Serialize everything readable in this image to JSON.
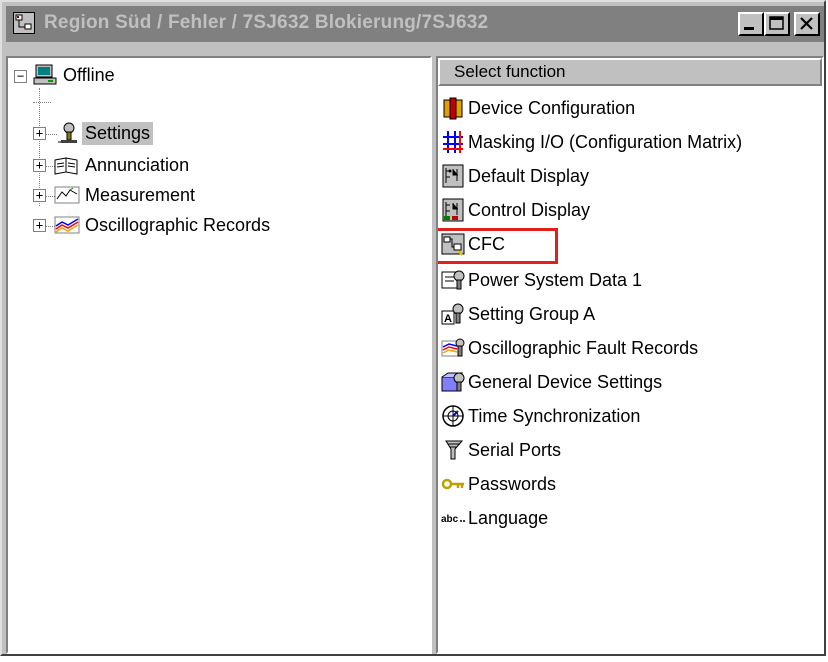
{
  "window": {
    "title": "Region Süd / Fehler / 7SJ632 Blokierung/7SJ632",
    "buttons": [
      "minimize",
      "maximize",
      "close"
    ]
  },
  "tree": {
    "root": {
      "label": "Offline",
      "icon": "computer-icon"
    },
    "items": [
      {
        "label": "Settings",
        "icon": "settings-icon",
        "selected": true
      },
      {
        "label": "Annunciation",
        "icon": "book-icon",
        "selected": false
      },
      {
        "label": "Measurement",
        "icon": "measurement-icon",
        "selected": false
      },
      {
        "label": "Oscillographic Records",
        "icon": "oscillograph-icon",
        "selected": false
      }
    ]
  },
  "functions": {
    "header": "Select function",
    "items": [
      {
        "label": "Device Configuration",
        "icon": "device-config-icon"
      },
      {
        "label": "Masking I/O (Configuration Matrix)",
        "icon": "matrix-icon"
      },
      {
        "label": "Default Display",
        "icon": "default-display-icon"
      },
      {
        "label": "Control Display",
        "icon": "control-display-icon"
      },
      {
        "label": "CFC",
        "icon": "cfc-icon",
        "highlighted": true
      },
      {
        "label": "Power System Data 1",
        "icon": "power-system-icon"
      },
      {
        "label": "Setting Group A",
        "icon": "setting-group-icon"
      },
      {
        "label": "Oscillographic Fault Records",
        "icon": "fault-records-icon"
      },
      {
        "label": "General Device Settings",
        "icon": "general-settings-icon"
      },
      {
        "label": "Time Synchronization",
        "icon": "time-sync-icon"
      },
      {
        "label": "Serial Ports",
        "icon": "serial-ports-icon"
      },
      {
        "label": "Passwords",
        "icon": "key-icon"
      },
      {
        "label": "Language",
        "icon": "language-icon"
      }
    ]
  },
  "colors": {
    "highlight": "#e0201c",
    "title_bar": "#808080",
    "face": "#c0c0c0"
  }
}
